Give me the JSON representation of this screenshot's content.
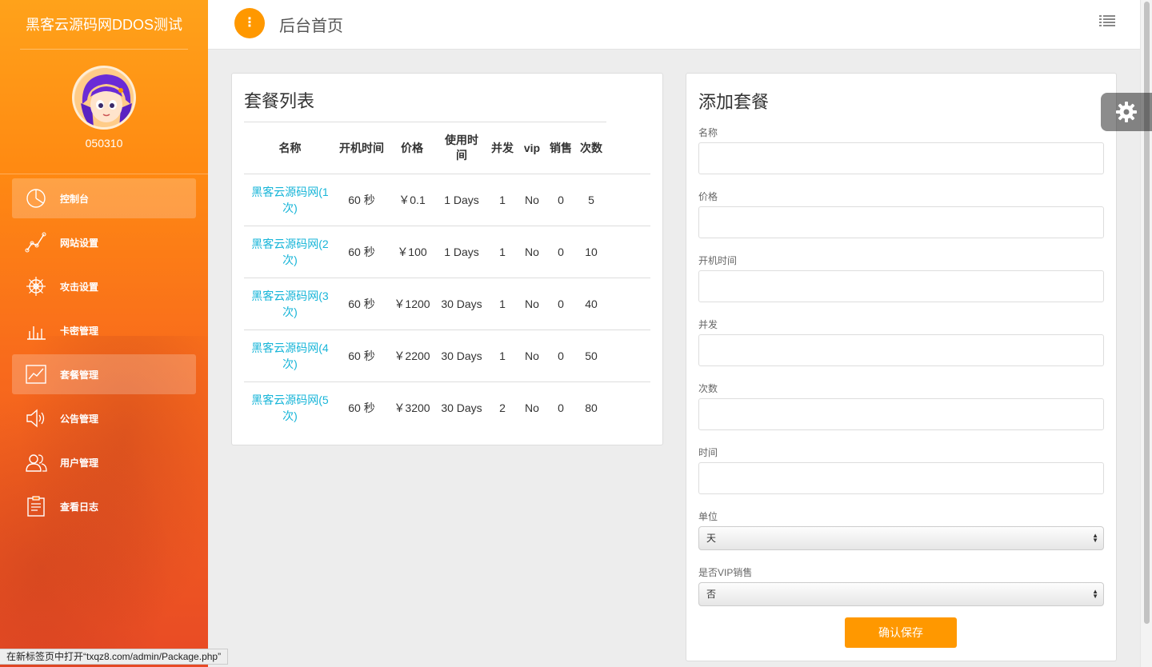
{
  "sidebar": {
    "brand": "黑客云源码网DDOS测试",
    "username": "050310",
    "items": [
      {
        "label": "控制台",
        "icon": "pie-chart-icon",
        "active": true
      },
      {
        "label": "网站设置",
        "icon": "line-graph-icon",
        "active": false
      },
      {
        "label": "攻击设置",
        "icon": "helm-icon",
        "active": false
      },
      {
        "label": "卡密管理",
        "icon": "bar-chart-icon",
        "active": false
      },
      {
        "label": "套餐管理",
        "icon": "trend-chart-icon",
        "active": true
      },
      {
        "label": "公告管理",
        "icon": "speaker-icon",
        "active": false
      },
      {
        "label": "用户管理",
        "icon": "users-icon",
        "active": false
      },
      {
        "label": "查看日志",
        "icon": "clipboard-icon",
        "active": false
      }
    ]
  },
  "header": {
    "menu_glyph": "⋮",
    "title": "后台首页"
  },
  "packages": {
    "title": "套餐列表",
    "columns": [
      "名称",
      "开机时间",
      "价格",
      "使用时间",
      "并发",
      "vip",
      "销售",
      "次数"
    ],
    "rows": [
      {
        "name": "黑客云源码网(1次)",
        "boot_time": "60 秒",
        "price": "￥0.1",
        "duration": "1 Days",
        "concurrent": "1",
        "vip": "No",
        "sales": "0",
        "count": "5"
      },
      {
        "name": "黑客云源码网(2次)",
        "boot_time": "60 秒",
        "price": "￥100",
        "duration": "1 Days",
        "concurrent": "1",
        "vip": "No",
        "sales": "0",
        "count": "10"
      },
      {
        "name": "黑客云源码网(3次)",
        "boot_time": "60 秒",
        "price": "￥1200",
        "duration": "30 Days",
        "concurrent": "1",
        "vip": "No",
        "sales": "0",
        "count": "40"
      },
      {
        "name": "黑客云源码网(4次)",
        "boot_time": "60 秒",
        "price": "￥2200",
        "duration": "30 Days",
        "concurrent": "1",
        "vip": "No",
        "sales": "0",
        "count": "50"
      },
      {
        "name": "黑客云源码网(5次)",
        "boot_time": "60 秒",
        "price": "￥3200",
        "duration": "30 Days",
        "concurrent": "2",
        "vip": "No",
        "sales": "0",
        "count": "80"
      }
    ]
  },
  "form": {
    "title": "添加套餐",
    "fields": [
      {
        "label": "名称",
        "value": ""
      },
      {
        "label": "价格",
        "value": ""
      },
      {
        "label": "开机时间",
        "value": ""
      },
      {
        "label": "并发",
        "value": ""
      },
      {
        "label": "次数",
        "value": ""
      },
      {
        "label": "时间",
        "value": ""
      }
    ],
    "unit": {
      "label": "单位",
      "value": "天"
    },
    "vip": {
      "label": "是否VIP销售",
      "value": "否"
    },
    "submit_label": "确认保存"
  },
  "status_bar": "在新标签页中打开“txqz8.com/admin/Package.php”",
  "colors": {
    "accent": "#ff9800",
    "link": "#17b5d8",
    "sidebar_top": "#ffa21a",
    "sidebar_bottom": "#e84a25"
  }
}
